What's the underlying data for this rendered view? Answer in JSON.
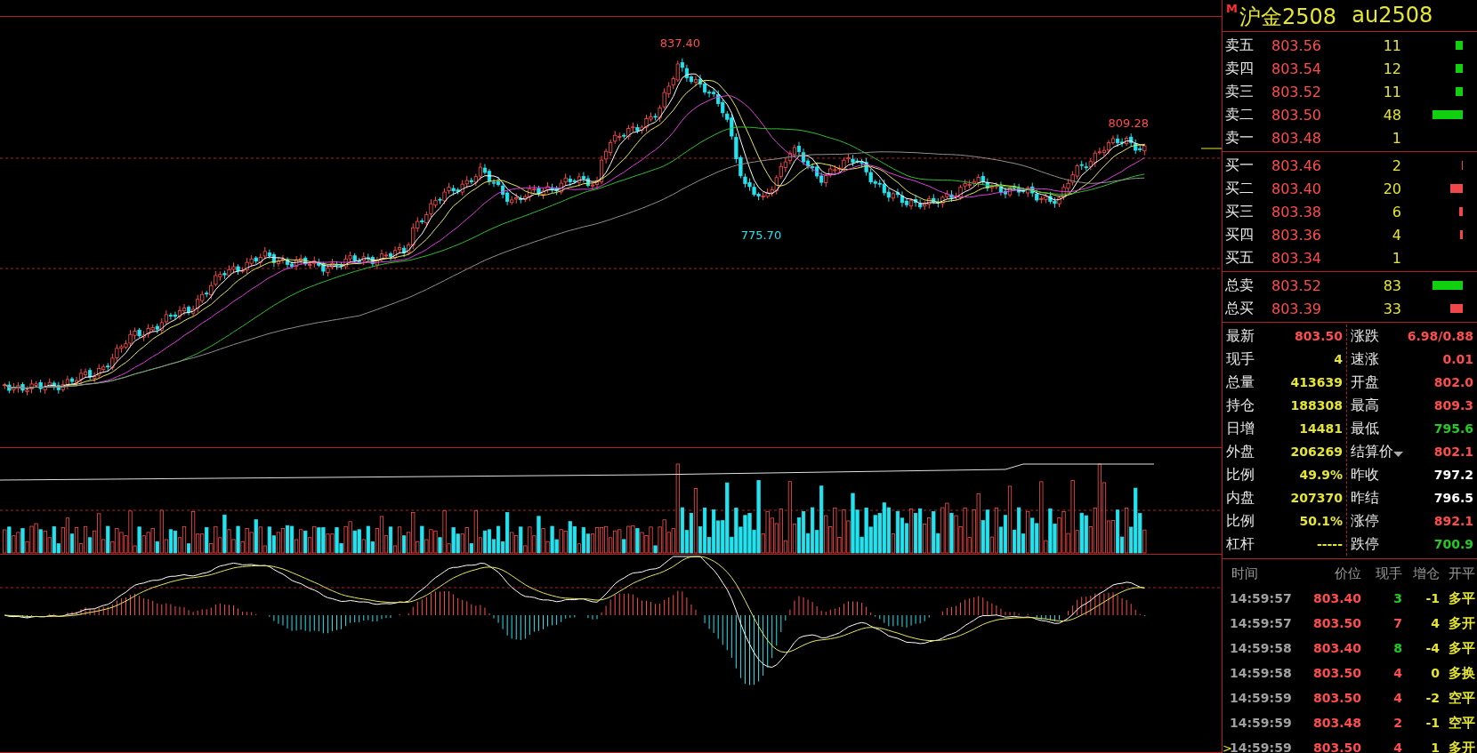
{
  "instrument": {
    "badge": "M",
    "name": "沪金2508",
    "code": "au2508"
  },
  "chart_labels": [
    {
      "kind": "high",
      "text": "837.40"
    },
    {
      "kind": "high",
      "text": "809.28"
    },
    {
      "kind": "low",
      "text": "775.70"
    }
  ],
  "order_book": [
    {
      "kind": "ask",
      "label": "卖五",
      "price": "803.56",
      "qty": "11"
    },
    {
      "kind": "ask",
      "label": "卖四",
      "price": "803.54",
      "qty": "12"
    },
    {
      "kind": "ask",
      "label": "卖三",
      "price": "803.52",
      "qty": "11"
    },
    {
      "kind": "ask",
      "label": "卖二",
      "price": "803.50",
      "qty": "48"
    },
    {
      "kind": "ask",
      "label": "卖一",
      "price": "803.48",
      "qty": "1"
    },
    {
      "kind": "bid",
      "label": "买一",
      "price": "803.46",
      "qty": "2"
    },
    {
      "kind": "bid",
      "label": "买二",
      "price": "803.40",
      "qty": "20"
    },
    {
      "kind": "bid",
      "label": "买三",
      "price": "803.38",
      "qty": "6"
    },
    {
      "kind": "bid",
      "label": "买四",
      "price": "803.36",
      "qty": "4"
    },
    {
      "kind": "bid",
      "label": "买五",
      "price": "803.34",
      "qty": "1"
    }
  ],
  "totals": [
    {
      "kind": "ask",
      "label": "总卖",
      "price": "803.52",
      "qty": "83"
    },
    {
      "kind": "bid",
      "label": "总买",
      "price": "803.39",
      "qty": "33"
    }
  ],
  "stats_left": [
    {
      "label": "最新",
      "value": "803.50",
      "color": "#ff4d4d"
    },
    {
      "label": "现手",
      "value": "4",
      "color": "#e6e62e"
    },
    {
      "label": "总量",
      "value": "413639",
      "color": "#e6e62e"
    },
    {
      "label": "持仓",
      "value": "188308",
      "color": "#e6e62e"
    },
    {
      "label": "日增",
      "value": "14481",
      "color": "#e6e62e"
    },
    {
      "label": "外盘",
      "value": "206269",
      "color": "#e6e62e"
    },
    {
      "label": "比例",
      "value": "49.9%",
      "color": "#e6e62e"
    },
    {
      "label": "内盘",
      "value": "207370",
      "color": "#e6e62e"
    },
    {
      "label": "比例",
      "value": "50.1%",
      "color": "#e6e62e"
    },
    {
      "label": "杠杆",
      "value": "-----",
      "color": "#e6e62e"
    }
  ],
  "stats_right": [
    {
      "label": "涨跌",
      "value": "6.98/0.88",
      "color": "#ff4d4d",
      "dropdown": false
    },
    {
      "label": "速涨",
      "value": "0.01",
      "color": "#ff4d4d",
      "dropdown": false
    },
    {
      "label": "开盘",
      "value": "802.0",
      "color": "#ff4d4d",
      "dropdown": false
    },
    {
      "label": "最高",
      "value": "809.3",
      "color": "#ff4d4d",
      "dropdown": false
    },
    {
      "label": "最低",
      "value": "795.6",
      "color": "#22cc22",
      "dropdown": false
    },
    {
      "label": "结算价",
      "value": "802.1",
      "color": "#ff4d4d",
      "dropdown": true
    },
    {
      "label": "昨收",
      "value": "797.2",
      "color": "#ffffff",
      "dropdown": false
    },
    {
      "label": "昨结",
      "value": "796.5",
      "color": "#ffffff",
      "dropdown": false
    },
    {
      "label": "涨停",
      "value": "892.1",
      "color": "#ff4d4d",
      "dropdown": false
    },
    {
      "label": "跌停",
      "value": "700.9",
      "color": "#22cc22",
      "dropdown": false
    }
  ],
  "trades": {
    "columns": [
      "时间",
      "价位",
      "现手",
      "增仓",
      "开平"
    ],
    "cursor": ">",
    "rows": [
      {
        "time": "14:59:57",
        "price": "803.40",
        "volume": "3",
        "color": "#22cc22",
        "change": "-1",
        "type": "多平",
        "selected": false
      },
      {
        "time": "14:59:57",
        "price": "803.50",
        "volume": "7",
        "color": "#ff4d4d",
        "change": "4",
        "type": "多开",
        "selected": false
      },
      {
        "time": "14:59:58",
        "price": "803.40",
        "volume": "8",
        "color": "#22cc22",
        "change": "-4",
        "type": "多平",
        "selected": false
      },
      {
        "time": "14:59:58",
        "price": "803.50",
        "volume": "4",
        "color": "#ff4d4d",
        "change": "0",
        "type": "多换",
        "selected": false
      },
      {
        "time": "14:59:59",
        "price": "803.50",
        "volume": "4",
        "color": "#ff4d4d",
        "change": "-2",
        "type": "空平",
        "selected": false
      },
      {
        "time": "14:59:59",
        "price": "803.48",
        "volume": "2",
        "color": "#ff4d4d",
        "change": "-1",
        "type": "空平",
        "selected": false
      },
      {
        "time": "14:59:59",
        "price": "803.50",
        "volume": "4",
        "color": "#ff4d4d",
        "change": "1",
        "type": "多开",
        "selected": true
      }
    ]
  }
}
